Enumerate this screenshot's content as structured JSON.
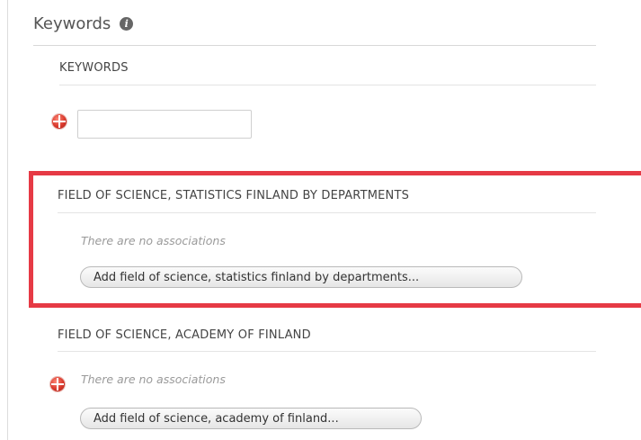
{
  "section": {
    "title": "Keywords",
    "info_icon": "info-icon"
  },
  "keywords": {
    "heading": "KEYWORDS",
    "input_value": "",
    "icon": "flag-icon"
  },
  "field_statistics": {
    "heading": "FIELD OF SCIENCE, STATISTICS FINLAND BY DEPARTMENTS",
    "empty_text": "There are no associations",
    "add_button_label": "Add field of science, statistics finland by departments..."
  },
  "field_academy": {
    "heading": "FIELD OF SCIENCE, ACADEMY OF FINLAND",
    "empty_text": "There are no associations",
    "add_button_label": "Add field of science, academy of finland...",
    "icon": "flag-icon"
  },
  "colors": {
    "highlight": "#e63a45",
    "divider": "#d8d8d8",
    "note_text": "#9a9a9a"
  }
}
